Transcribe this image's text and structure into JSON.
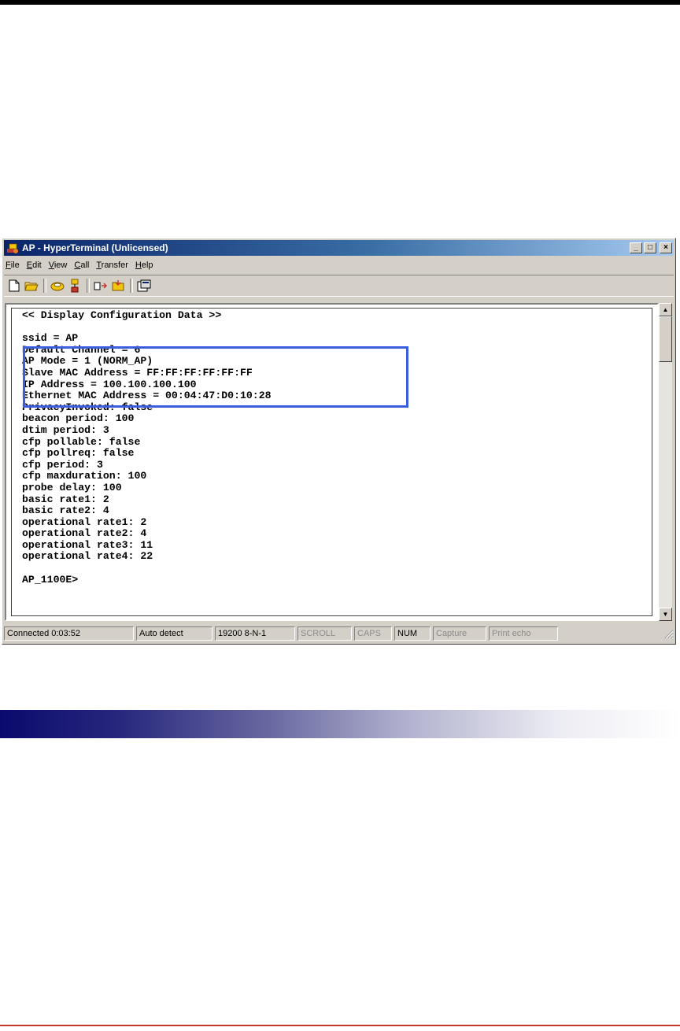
{
  "window": {
    "title": "AP - HyperTerminal (Unlicensed)",
    "buttons": {
      "minimize": "_",
      "maximize": "□",
      "close": "×"
    }
  },
  "menu": [
    {
      "pre": "",
      "key": "F",
      "post": "ile"
    },
    {
      "pre": "",
      "key": "E",
      "post": "dit"
    },
    {
      "pre": "",
      "key": "V",
      "post": "iew"
    },
    {
      "pre": "",
      "key": "C",
      "post": "all"
    },
    {
      "pre": "",
      "key": "T",
      "post": "ransfer"
    },
    {
      "pre": "",
      "key": "H",
      "post": "elp"
    }
  ],
  "toolbar": {
    "icons": [
      "new-file-icon",
      "open-folder-icon",
      "connect-phone-icon",
      "disconnect-icon",
      "send-file-icon",
      "receive-file-icon",
      "properties-icon"
    ]
  },
  "terminal": {
    "lines": [
      "<< Display Configuration Data >>",
      "",
      "ssid = AP",
      "Default Channel = 6",
      "AP Mode = 1 (NORM_AP)",
      "Slave MAC Address = FF:FF:FF:FF:FF:FF",
      "IP Address = 100.100.100.100",
      "Ethernet MAC Address = 00:04:47:D0:10:28",
      "PrivacyInvoked: false",
      "beacon period: 100",
      "dtim period: 3",
      "cfp pollable: false",
      "cfp pollreq: false",
      "cfp period: 3",
      "cfp maxduration: 100",
      "probe delay: 100",
      "basic rate1: 2",
      "basic rate2: 4",
      "operational rate1: 2",
      "operational rate2: 4",
      "operational rate3: 11",
      "operational rate4: 22",
      "",
      "AP_1100E>"
    ]
  },
  "scrollbar": {
    "up": "▲",
    "down": "▼"
  },
  "statusbar": {
    "connected": "Connected 0:03:52",
    "detect": "Auto detect",
    "settings": "19200 8-N-1",
    "scroll": "SCROLL",
    "caps": "CAPS",
    "num": "NUM",
    "capture": "Capture",
    "print_echo": "Print echo"
  },
  "colors": {
    "highlight_box": "#3b5ee0",
    "title_bar": "#0a246a",
    "section_bar": "#0a0a6e",
    "bottom_rule": "#c0392b"
  }
}
